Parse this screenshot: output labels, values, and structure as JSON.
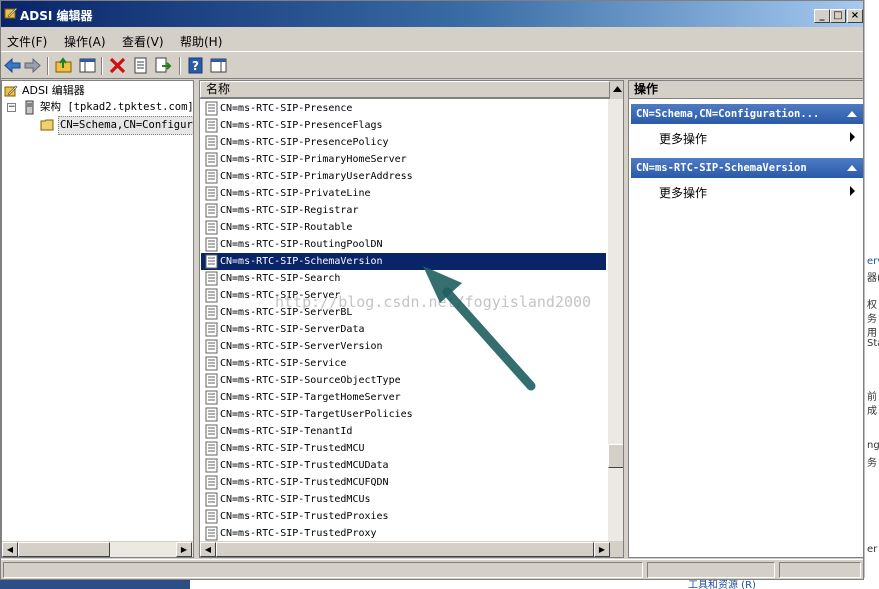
{
  "window": {
    "title": "ADSI 编辑器"
  },
  "titlebar_buttons": {
    "minimize": "_",
    "maximize": "□",
    "close": "×"
  },
  "menu": [
    {
      "label": "文件(F)"
    },
    {
      "label": "操作(A)"
    },
    {
      "label": "查看(V)"
    },
    {
      "label": "帮助(H)"
    }
  ],
  "toolbar": {
    "icons": [
      "back-icon",
      "forward-icon",
      "up-folder-icon",
      "show-hide-tree-icon",
      "delete-icon",
      "properties-icon",
      "export-list-icon",
      "help-icon",
      "show-action-pane-icon"
    ]
  },
  "tree": {
    "root": "ADSI 编辑器",
    "schema": "架构 [tpkad2.tpktest.com]",
    "container": "CN=Schema,CN=Configuration,DC=tpktest,DC=com"
  },
  "list": {
    "column_header": "名称",
    "items": [
      "CN=ms-RTC-SIP-Presence",
      "CN=ms-RTC-SIP-PresenceFlags",
      "CN=ms-RTC-SIP-PresencePolicy",
      "CN=ms-RTC-SIP-PrimaryHomeServer",
      "CN=ms-RTC-SIP-PrimaryUserAddress",
      "CN=ms-RTC-SIP-PrivateLine",
      "CN=ms-RTC-SIP-Registrar",
      "CN=ms-RTC-SIP-Routable",
      "CN=ms-RTC-SIP-RoutingPoolDN",
      "CN=ms-RTC-SIP-SchemaVersion",
      "CN=ms-RTC-SIP-Search",
      "CN=ms-RTC-SIP-Server",
      "CN=ms-RTC-SIP-ServerBL",
      "CN=ms-RTC-SIP-ServerData",
      "CN=ms-RTC-SIP-ServerVersion",
      "CN=ms-RTC-SIP-Service",
      "CN=ms-RTC-SIP-SourceObjectType",
      "CN=ms-RTC-SIP-TargetHomeServer",
      "CN=ms-RTC-SIP-TargetUserPolicies",
      "CN=ms-RTC-SIP-TenantId",
      "CN=ms-RTC-SIP-TrustedMCU",
      "CN=ms-RTC-SIP-TrustedMCUData",
      "CN=ms-RTC-SIP-TrustedMCUFQDN",
      "CN=ms-RTC-SIP-TrustedMCUs",
      "CN=ms-RTC-SIP-TrustedProxies",
      "CN=ms-RTC-SIP-TrustedProxy"
    ],
    "selected_index": 9
  },
  "watermark": "http://blog.csdn.net/fogyisland2000",
  "actions": {
    "header": "操作",
    "sections": [
      {
        "title": "CN=Schema,CN=Configuration...",
        "item": "更多操作"
      },
      {
        "title": "CN=ms-RTC-SIP-SchemaVersion",
        "item": "更多操作"
      }
    ]
  },
  "background_fragments": {
    "right": [
      "erv",
      "器(",
      "权",
      "务",
      "用",
      "Sta",
      "前",
      "成",
      "ng",
      "务",
      "er"
    ],
    "bottom": "工具和资源 (R)"
  },
  "colors": {
    "selection": "#0a246a",
    "section_header": "#2a5aa8",
    "arrow": "#1f5f5f"
  }
}
